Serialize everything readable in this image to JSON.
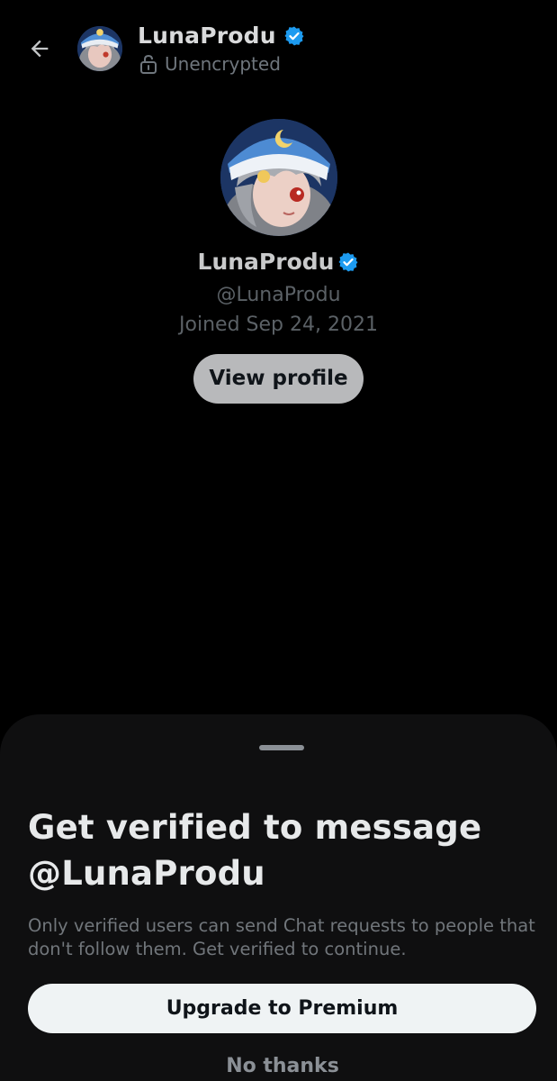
{
  "header": {
    "back_icon": "arrow-left-icon",
    "name": "LunaProdu",
    "verified_icon": "verified-badge-icon",
    "lock_icon": "unlocked-padlock-icon",
    "encryption_status": "Unencrypted"
  },
  "profile": {
    "name": "LunaProdu",
    "handle": "@LunaProdu",
    "joined": "Joined Sep 24, 2021",
    "view_profile_label": "View profile"
  },
  "sheet": {
    "title_line1": "Get verified to message",
    "title_line2": "@LunaProdu",
    "description": "Only verified users can send Chat requests to people that don't follow them. Get verified to continue.",
    "upgrade_label": "Upgrade to Premium",
    "no_thanks_label": "No thanks"
  },
  "colors": {
    "background": "#000000",
    "verified_blue": "#1d9bf0",
    "sheet_background": "#0f0f10",
    "primary_button": "#eff3f4",
    "secondary_button": "#b8b9bb"
  }
}
